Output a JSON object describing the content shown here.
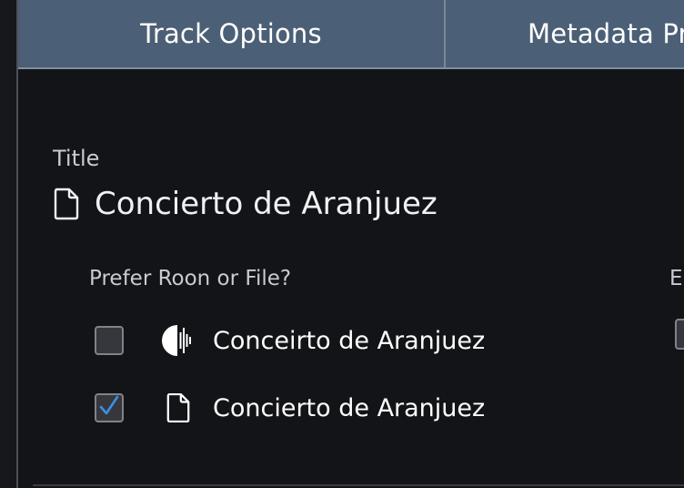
{
  "tabs": [
    {
      "label": "Track Options"
    },
    {
      "label": "Metadata Pr"
    }
  ],
  "title_section": {
    "label": "Title",
    "value": "Concierto de Aranjuez",
    "icon": "file-icon"
  },
  "prefer": {
    "question": "Prefer Roon or File?",
    "right_label_partial": "E",
    "options": [
      {
        "source": "Roon",
        "icon": "roon-logo-icon",
        "text": "Conceirto de Aranjuez",
        "checked": false
      },
      {
        "source": "File",
        "icon": "file-icon",
        "text": "Concierto de Aranjuez",
        "checked": true
      }
    ]
  },
  "colors": {
    "tab_bar": "#4b5f76",
    "background": "#131418",
    "checkmark": "#3c8ee6"
  }
}
